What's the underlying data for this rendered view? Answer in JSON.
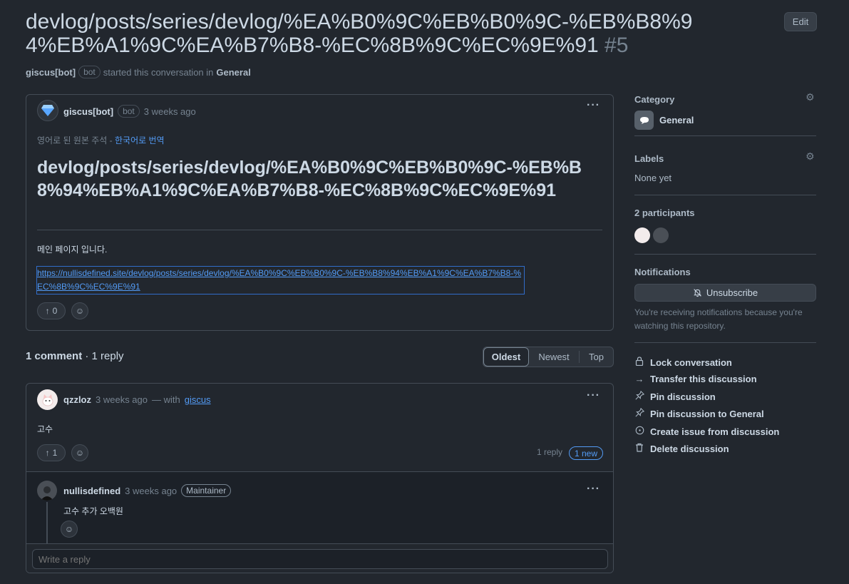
{
  "header": {
    "title": "devlog/posts/series/devlog/%EA%B0%9C%EB%B0%9C-%EB%B8%94%EB%A1%9C%EA%B7%B8-%EC%8B%9C%EC%9E%91",
    "number": "#5",
    "edit_label": "Edit",
    "author": "giscus[bot]",
    "author_badge": "bot",
    "started_text": "started this conversation in",
    "category": "General"
  },
  "post": {
    "author": "giscus[bot]",
    "badge": "bot",
    "time": "3 weeks ago",
    "translate_note": "영어로 된 원본 주석 -",
    "translate_link": "한국어로 번역",
    "heading": "devlog/posts/series/devlog/%EA%B0%9C%EB%B0%9C-%EB%B8%94%EB%A1%9C%EA%B7%B8-%EC%8B%9C%EC%9E%91",
    "body": "메인 페이지 입니다.",
    "url": "https://nullisdefined.site/devlog/posts/series/devlog/%EA%B0%9C%EB%B0%9C-%EB%B8%94%EB%A1%9C%EA%B7%B8-%EC%8B%9C%EC%9E%91",
    "upvotes": "0"
  },
  "comments_bar": {
    "count_label": "1 comment",
    "reply_label": "· 1 reply",
    "sort_options": [
      "Oldest",
      "Newest",
      "Top"
    ],
    "active_sort": "Oldest"
  },
  "comment": {
    "author": "qzzloz",
    "time": "3 weeks ago",
    "with_text": "— with",
    "with_link": "giscus",
    "body": "고수",
    "upvotes": "1",
    "reply_count": "1 reply",
    "new_badge": "1 new"
  },
  "reply": {
    "author": "nullisdefined",
    "time": "3 weeks ago",
    "badge": "Maintainer",
    "body": "고수 추가 오백원",
    "placeholder": "Write a reply"
  },
  "sidebar": {
    "category_heading": "Category",
    "category_name": "General",
    "labels_heading": "Labels",
    "labels_value": "None yet",
    "participants_heading": "2 participants",
    "notifications_heading": "Notifications",
    "unsubscribe_label": "Unsubscribe",
    "notif_reason": "You're receiving notifications because you're watching this repository.",
    "actions": [
      {
        "label": "Lock conversation",
        "icon": "lock-icon"
      },
      {
        "label": "Transfer this discussion",
        "icon": "arrow-right-icon"
      },
      {
        "label": "Pin discussion",
        "icon": "pin-icon"
      },
      {
        "label": "Pin discussion to General",
        "icon": "pin-icon"
      },
      {
        "label": "Create issue from discussion",
        "icon": "issue-icon"
      },
      {
        "label": "Delete discussion",
        "icon": "trash-icon"
      }
    ]
  },
  "colors": {
    "background": "#22272e",
    "border": "#444c56",
    "link": "#539bf5",
    "text": "#adbac7"
  }
}
